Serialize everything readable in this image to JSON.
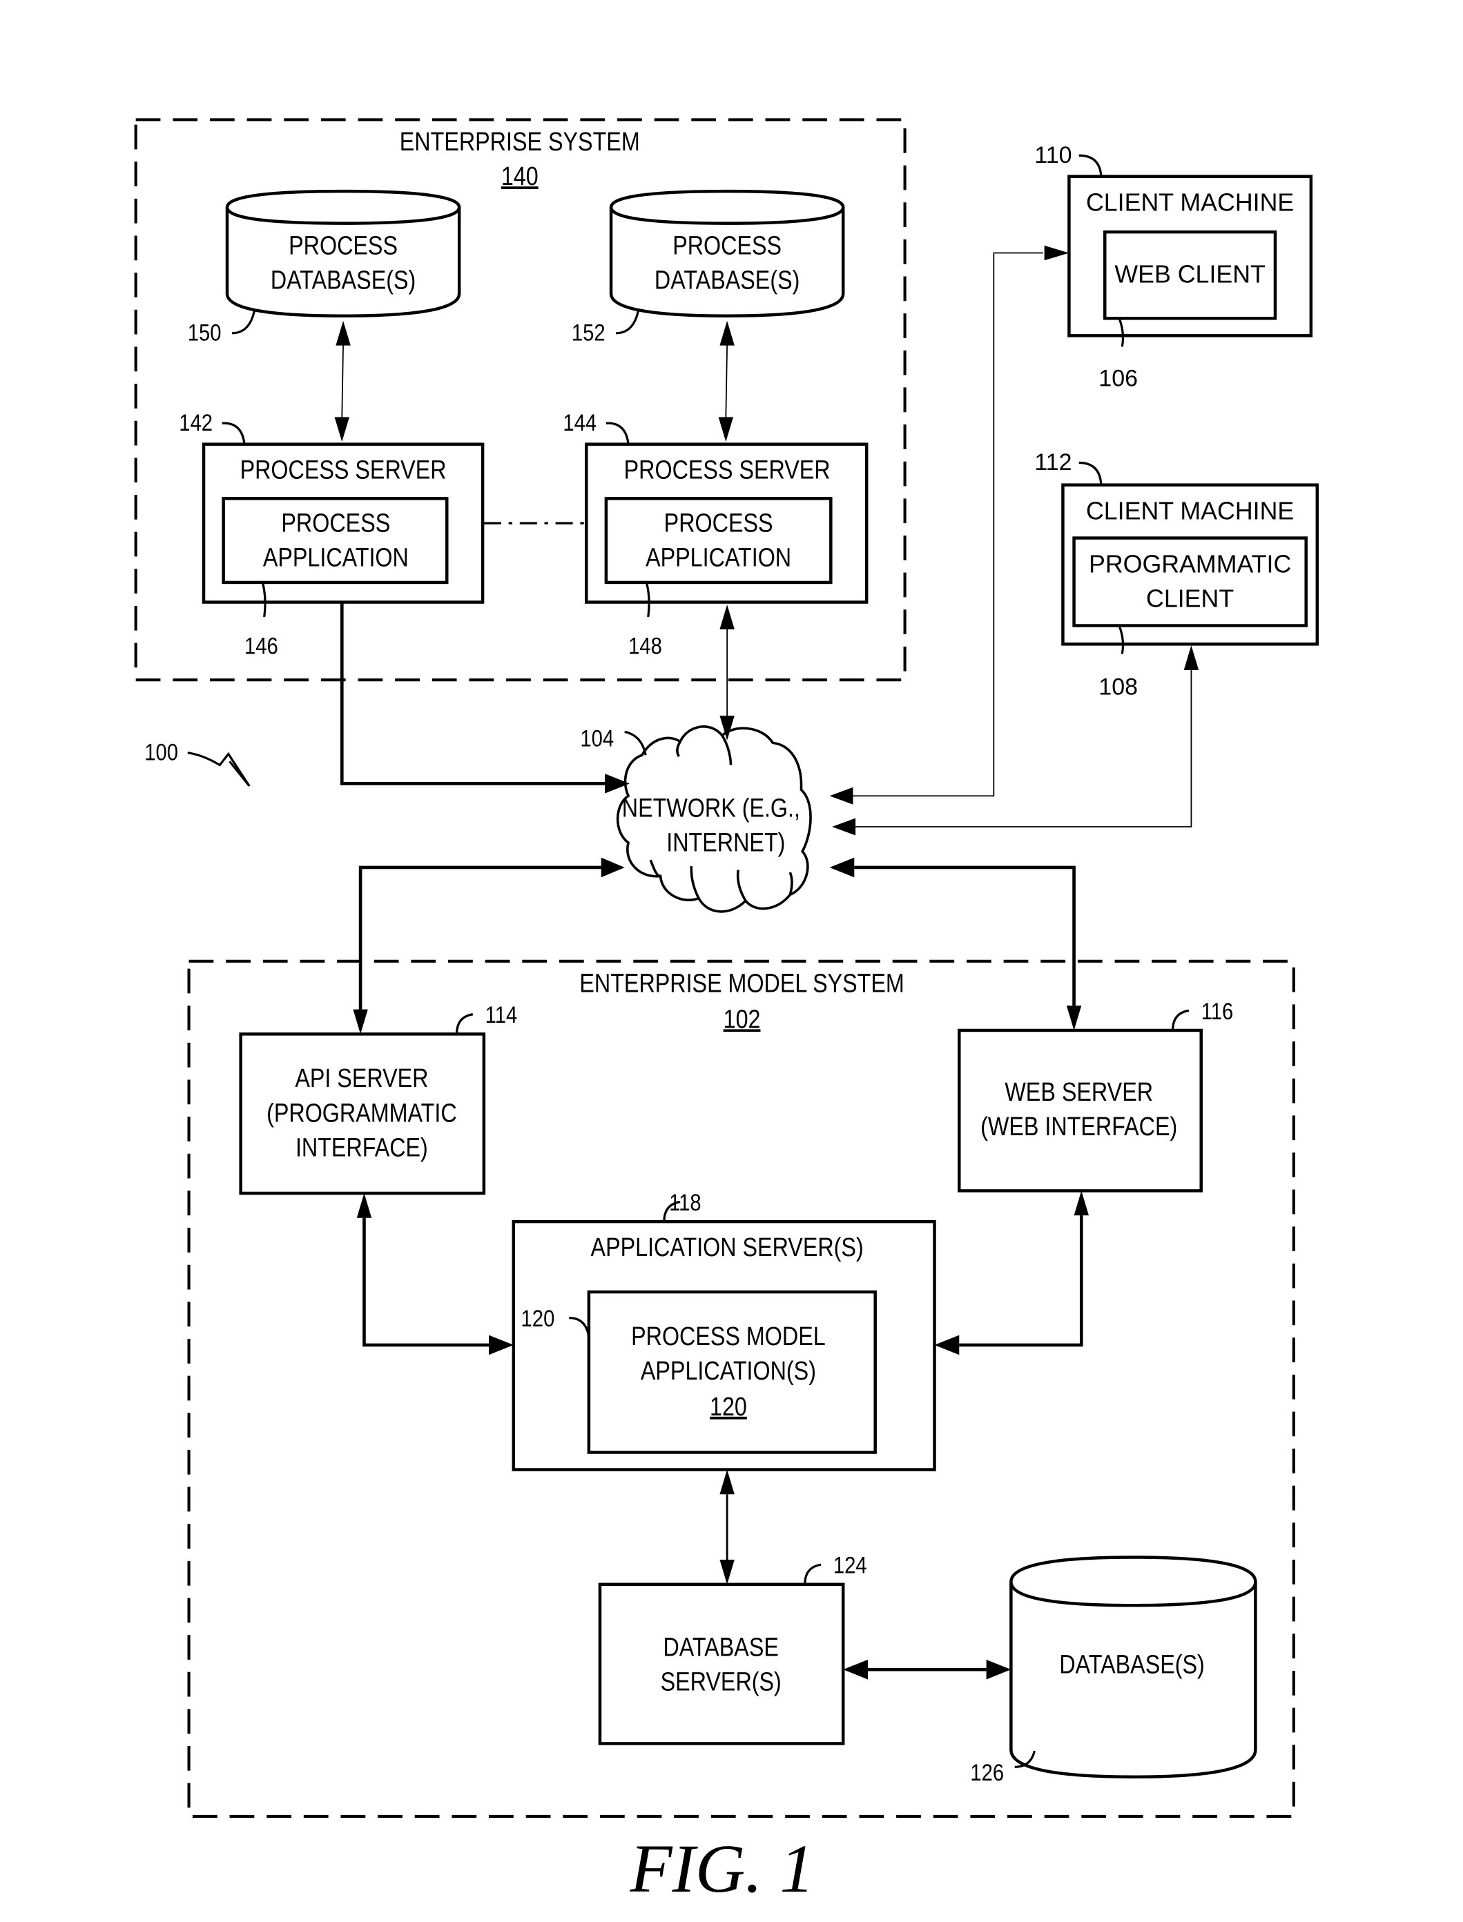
{
  "figure": {
    "caption": "FIG. 1",
    "system_ref": "100"
  },
  "enterprise_system": {
    "title": "ENTERPRISE SYSTEM",
    "ref": "140",
    "databases": [
      {
        "line1": "PROCESS",
        "line2": "DATABASE(S)",
        "ref": "150"
      },
      {
        "line1": "PROCESS",
        "line2": "DATABASE(S)",
        "ref": "152"
      }
    ],
    "servers": [
      {
        "title": "PROCESS SERVER",
        "ref": "142",
        "app_line1": "PROCESS",
        "app_line2": "APPLICATION",
        "app_ref": "146"
      },
      {
        "title": "PROCESS SERVER",
        "ref": "144",
        "app_line1": "PROCESS",
        "app_line2": "APPLICATION",
        "app_ref": "148"
      }
    ]
  },
  "clients": [
    {
      "title": "CLIENT MACHINE",
      "ref": "110",
      "inner_line1": "WEB CLIENT",
      "inner_line2": "",
      "inner_ref": "106"
    },
    {
      "title": "CLIENT MACHINE",
      "ref": "112",
      "inner_line1": "PROGRAMMATIC",
      "inner_line2": "CLIENT",
      "inner_ref": "108"
    }
  ],
  "network": {
    "line1": "NETWORK (E.G.,",
    "line2": "INTERNET)",
    "ref": "104"
  },
  "enterprise_model_system": {
    "title": "ENTERPRISE MODEL SYSTEM",
    "ref": "102",
    "api_server": {
      "line1": "API SERVER",
      "line2": "(PROGRAMMATIC",
      "line3": "INTERFACE)",
      "ref": "114"
    },
    "web_server": {
      "line1": "WEB SERVER",
      "line2": "(WEB INTERFACE)",
      "ref": "116"
    },
    "app_server": {
      "title": "APPLICATION SERVER(S)",
      "ref": "118",
      "inner_line1": "PROCESS MODEL",
      "inner_line2": "APPLICATION(S)",
      "inner_ref_underlined": "120",
      "inner_ref": "120"
    },
    "db_server": {
      "line1": "DATABASE",
      "line2": "SERVER(S)",
      "ref": "124"
    },
    "database": {
      "label": "DATABASE(S)",
      "ref": "126"
    }
  }
}
